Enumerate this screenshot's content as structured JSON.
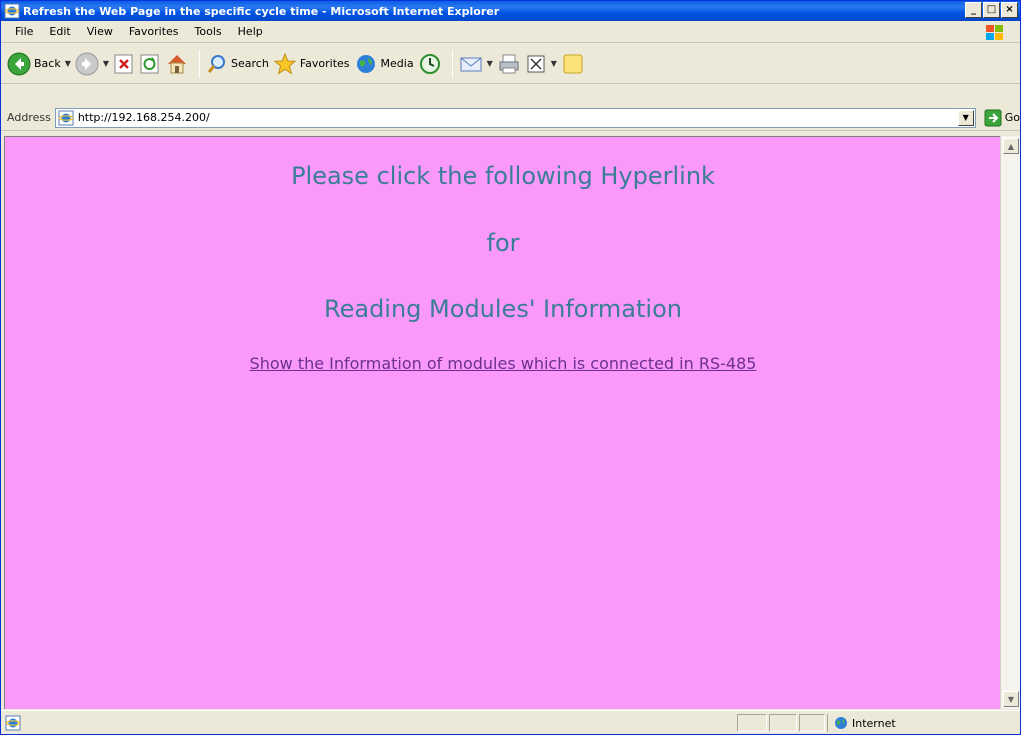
{
  "window": {
    "title": "Refresh the Web Page in the specific cycle time - Microsoft Internet Explorer",
    "minimize_glyph": "_",
    "maximize_glyph": "□",
    "close_glyph": "×"
  },
  "menu": {
    "items": [
      "File",
      "Edit",
      "View",
      "Favorites",
      "Tools",
      "Help"
    ]
  },
  "toolbar": {
    "back_label": "Back",
    "search_label": "Search",
    "favorites_label": "Favorites",
    "media_label": "Media"
  },
  "address": {
    "label": "Address",
    "url": "http://192.168.254.200/",
    "go_label": "Go"
  },
  "content": {
    "background_color": "#fb99fb",
    "heading_line1": "Please click the following Hyperlink",
    "heading_line2": "for",
    "heading_line3": "Reading Modules' Information",
    "link_text": "Show the Information of modules which is connected in RS-485"
  },
  "status": {
    "zone_label": "Internet"
  }
}
